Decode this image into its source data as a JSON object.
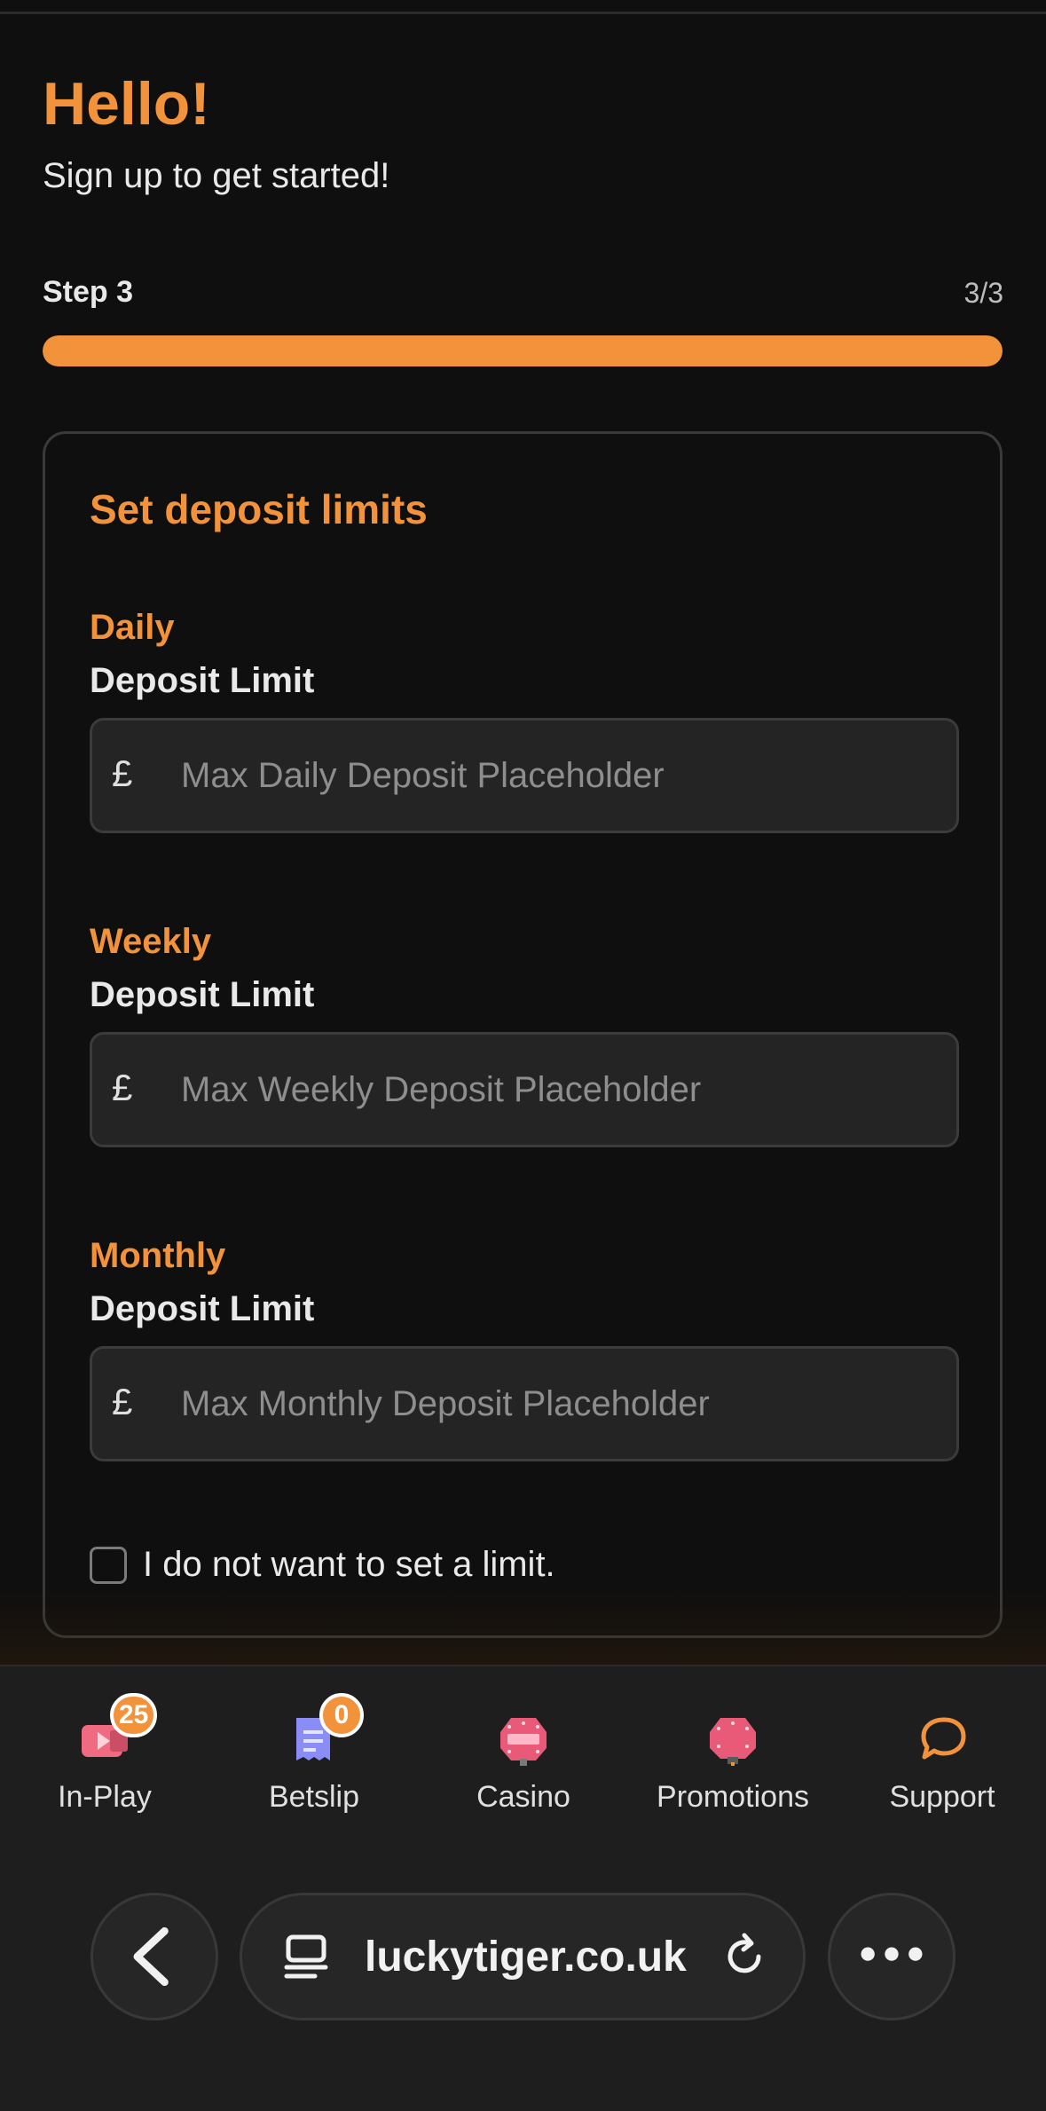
{
  "header": {
    "title": "Hello!",
    "subtitle": "Sign up to get started!"
  },
  "progress": {
    "step_label": "Step 3",
    "step_count": "3/3",
    "fraction": 1.0,
    "color": "#f2923a"
  },
  "card": {
    "title": "Set deposit limits",
    "currency_symbol": "£",
    "fields": [
      {
        "period": "Daily",
        "label": "Deposit Limit",
        "placeholder": "Max Daily Deposit Placeholder",
        "value": ""
      },
      {
        "period": "Weekly",
        "label": "Deposit Limit",
        "placeholder": "Max Weekly Deposit Placeholder",
        "value": ""
      },
      {
        "period": "Monthly",
        "label": "Deposit Limit",
        "placeholder": "Max Monthly Deposit Placeholder",
        "value": ""
      }
    ],
    "no_limit_label": "I do not want to set a limit.",
    "no_limit_checked": false
  },
  "bottom_nav": {
    "items": [
      {
        "label": "In-Play",
        "icon": "video-play-icon",
        "badge": "25"
      },
      {
        "label": "Betslip",
        "icon": "receipt-icon",
        "badge": "0"
      },
      {
        "label": "Casino",
        "icon": "casino-chip-icon"
      },
      {
        "label": "Promotions",
        "icon": "promotions-tag-icon"
      },
      {
        "label": "Support",
        "icon": "chat-bubble-icon"
      }
    ]
  },
  "browser": {
    "url": "luckytiger.co.uk",
    "back_icon": "chevron-left-icon",
    "site_icon": "tabs-icon",
    "reload_icon": "reload-icon",
    "more_icon": "more-dots-icon"
  },
  "colors": {
    "accent": "#f2923a",
    "background": "#0f0f0f",
    "input_bg": "#242424"
  }
}
